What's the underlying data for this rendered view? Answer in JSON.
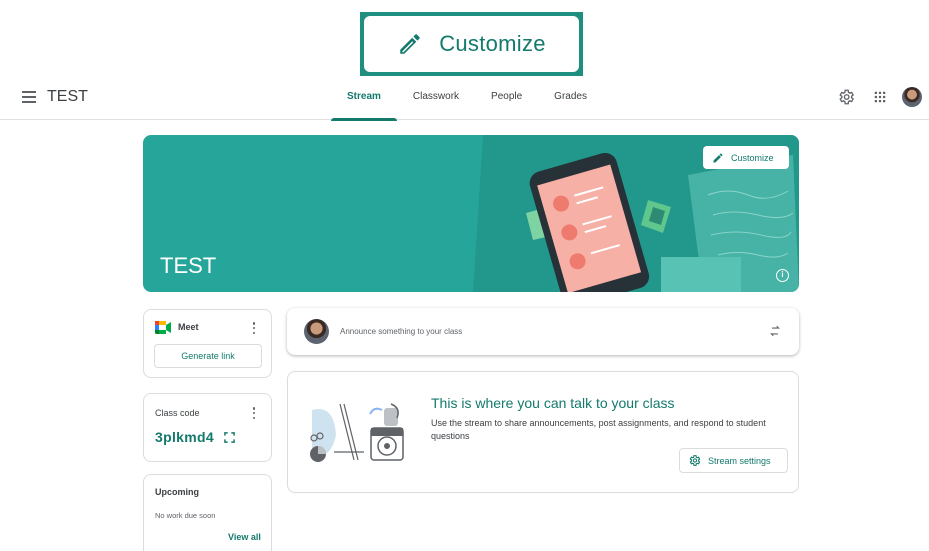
{
  "zoom_callout": {
    "label": "Customize",
    "icon": "pencil-icon"
  },
  "header": {
    "class_name": "TEST",
    "tabs": [
      {
        "label": "Stream",
        "active": true
      },
      {
        "label": "Classwork",
        "active": false
      },
      {
        "label": "People",
        "active": false
      },
      {
        "label": "Grades",
        "active": false
      }
    ],
    "icons": [
      "menu-icon",
      "settings-icon",
      "apps-grid-icon",
      "account-avatar"
    ]
  },
  "banner": {
    "title": "TEST",
    "customize_label": "Customize",
    "color": "#26a69a"
  },
  "meet": {
    "label": "Meet",
    "button": "Generate link"
  },
  "class_code": {
    "label": "Class code",
    "code": "3plkmd4"
  },
  "upcoming": {
    "title": "Upcoming",
    "empty": "No work due soon",
    "view_all": "View all"
  },
  "announce": {
    "placeholder": "Announce something to your class"
  },
  "stream_empty": {
    "title": "This is where you can talk to your class",
    "description": "Use the stream to share announcements, post assignments, and respond to student questions",
    "settings_button": "Stream settings"
  },
  "colors": {
    "accent": "#137a6c",
    "banner": "#26a69a",
    "border": "#dadce0"
  }
}
